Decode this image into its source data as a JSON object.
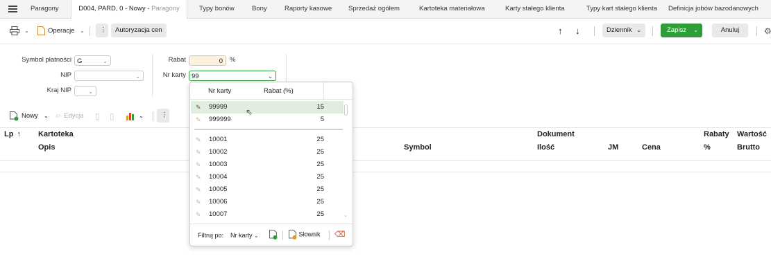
{
  "tabs": [
    {
      "label": "Paragony"
    },
    {
      "label": "D004, PARD, 0 - Nowy - ",
      "suffix": "Paragony"
    },
    {
      "label": "Typy bonów"
    },
    {
      "label": "Bony"
    },
    {
      "label": "Raporty kasowe"
    },
    {
      "label": "Sprzedaż ogółem"
    },
    {
      "label": "Kartoteka materiałowa"
    },
    {
      "label": "Karty stałego klienta"
    },
    {
      "label": "Typy kart stałego klienta"
    },
    {
      "label": "Definicja jobów bazodanowych"
    }
  ],
  "toolbar": {
    "operations_label": "Operacje",
    "authorize_label": "Autoryzacja cen",
    "journal_label": "Dziennik",
    "save_label": "Zapisz",
    "cancel_label": "Anuluj"
  },
  "form": {
    "payment_symbol_label": "Symbol płatności",
    "payment_symbol_value": "G",
    "nip_label": "NIP",
    "nip_value": "",
    "country_nip_label": "Kraj NIP",
    "country_nip_value": "",
    "discount_label": "Rabat",
    "discount_value": "0",
    "discount_unit": "%",
    "card_label": "Nr karty",
    "card_value": "99"
  },
  "grid_toolbar": {
    "new_label": "Nowy",
    "edit_label": "Edycja"
  },
  "grid": {
    "headers_row1": [
      "Lp",
      "Kartoteka",
      "Dokument",
      "Rabaty",
      "Wartość"
    ],
    "headers_row2": [
      "Opis",
      "Symbol",
      "Ilość",
      "JM",
      "Cena",
      "%",
      "Brutto"
    ],
    "sort_indicator": "↑"
  },
  "dropdown": {
    "col_card": "Nr karty",
    "col_discount": "Rabat (%)",
    "top_rows": [
      {
        "card": "99999",
        "discount": "15"
      },
      {
        "card": "999999",
        "discount": "5"
      }
    ],
    "rows": [
      {
        "card": "10001",
        "discount": "25"
      },
      {
        "card": "10002",
        "discount": "25"
      },
      {
        "card": "10003",
        "discount": "25"
      },
      {
        "card": "10004",
        "discount": "25"
      },
      {
        "card": "10005",
        "discount": "25"
      },
      {
        "card": "10006",
        "discount": "25"
      },
      {
        "card": "10007",
        "discount": "25"
      }
    ],
    "filter_label": "Filtruj po:",
    "filter_value": "Nr karty",
    "dictionary_label": "Słownik"
  },
  "colors": {
    "accent_green": "#2f9e3a",
    "selected_row": "#dfeedd",
    "active_input": "#fdf1dc"
  }
}
